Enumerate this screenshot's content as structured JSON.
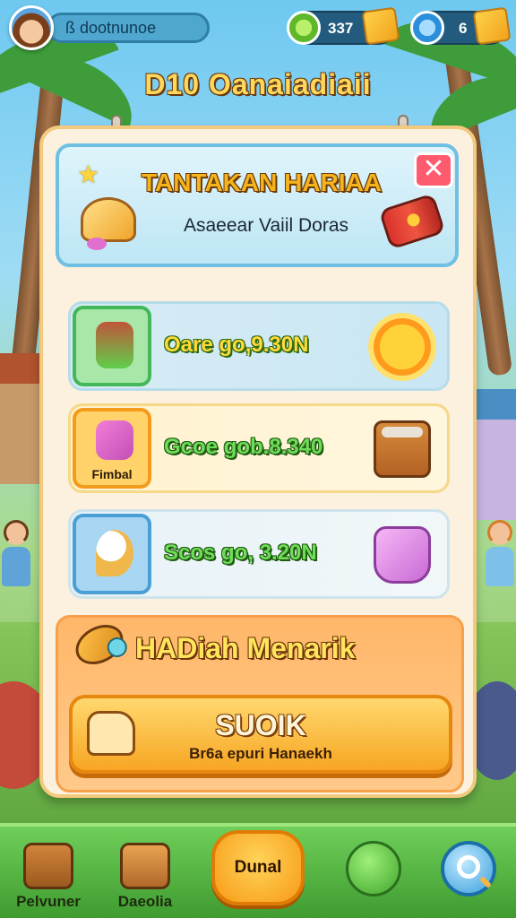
{
  "top_bar": {
    "player_name": "ß dootnunoe",
    "currency_green": "337",
    "currency_blue": "6"
  },
  "screen_title": "D10 Oanaiadiaii",
  "banner": {
    "title": "TANTAKAN HARIAA",
    "subtitle": "Asaeear Vaiil Doras",
    "close_symbol": "✕"
  },
  "tasks": [
    {
      "text": "Oare go,9.30N",
      "tile_label": ""
    },
    {
      "text": "Gcoe gob.8.340",
      "tile_label": "Fimbal"
    },
    {
      "text": "Scos go, 3.20N",
      "tile_label": ""
    }
  ],
  "bonus": {
    "title": "HADiah Menarik",
    "claim_title": "SUOIK",
    "claim_subtitle": "Br6a epuri Hanaekh"
  },
  "bottom_nav": {
    "left_label": "Pelvuner",
    "second_label": "Daeolia",
    "center_label": "Dunal"
  },
  "colors": {
    "accent_orange": "#f7a623",
    "title_yellow": "#ffd75a",
    "panel_bg": "#fbf1de",
    "close_red": "#ff5b6e"
  }
}
